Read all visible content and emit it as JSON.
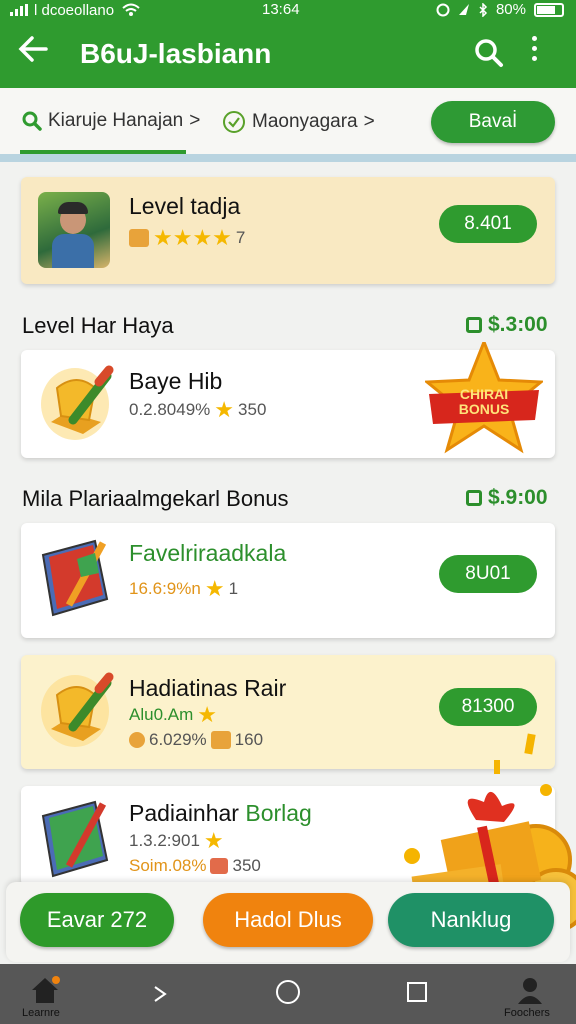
{
  "status_bar": {
    "carrier": "l dcoeollano",
    "time": "13:64",
    "battery": "80%"
  },
  "app_bar": {
    "title": "B6uJ-lasbiann"
  },
  "tabs": [
    {
      "label": "Kiaruje Hanajan",
      "chevron": ">"
    },
    {
      "label": "Maonyagara",
      "chevron": ">"
    }
  ],
  "save_button": "Bavaİ",
  "cards": [
    {
      "title": "Level tadja",
      "rating_count": "7",
      "button": "8.401"
    },
    {
      "section": "Level Har Haya",
      "section_price": "$.3:00",
      "title": "Baye Hib",
      "meta": "0.2.8049%",
      "rating_count": "350",
      "badge_line1": "CHIRAI",
      "badge_line2": "BONUS"
    },
    {
      "section": "Mila Plariaalmgekarl Bonus",
      "section_price": "$.9:00",
      "title": "Favelriraadkala",
      "meta": "16.6:9%n",
      "rating_count": "1",
      "button": "8U01"
    },
    {
      "title": "Hadiatinas Rair",
      "meta": "Alu0.Am",
      "meta2": "6.029%",
      "rating_count": "160",
      "button": "81300"
    },
    {
      "title_part1": "Padiainhar",
      "title_part2": "Borlag",
      "meta": "1.3.2:901",
      "meta2": "Soim.08%",
      "rating_count": "350"
    }
  ],
  "bottom_actions": [
    {
      "label": "Eavar 272",
      "color": "#2e9a2a"
    },
    {
      "label": "Hadol Dlus",
      "color": "#f0830e"
    },
    {
      "label": "Nanklug",
      "color": "#1f9166"
    }
  ],
  "nav": {
    "left_label": "Learnre",
    "right_label": "Foochers"
  },
  "colors": {
    "primary": "#2f9b2f",
    "orange": "#f0830e",
    "teal": "#1f9166",
    "cream": "#f9e9c2"
  }
}
